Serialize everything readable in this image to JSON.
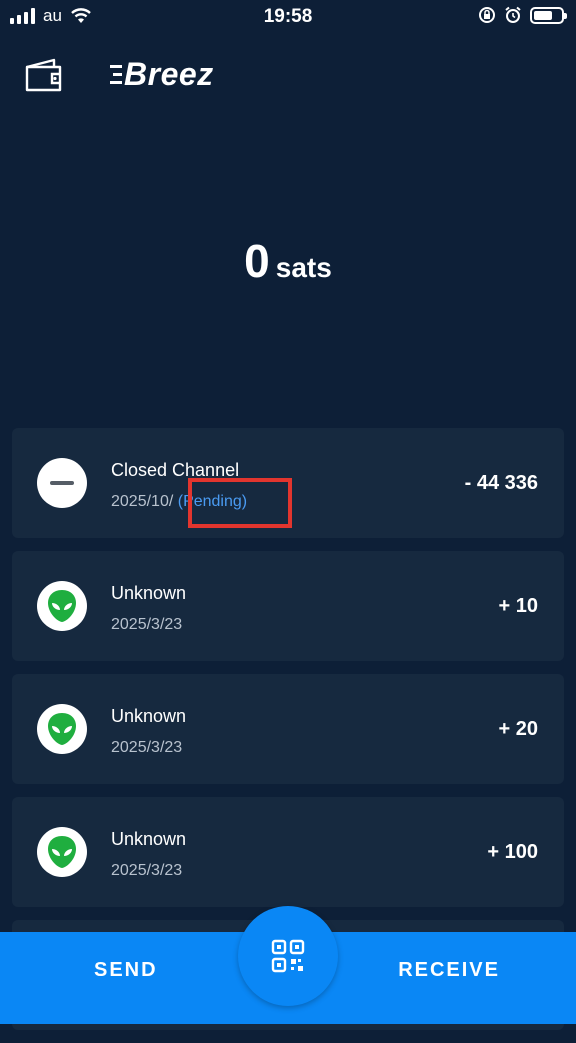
{
  "status_bar": {
    "carrier": "au",
    "time": "19:58"
  },
  "header": {
    "logo_text": "Breez"
  },
  "balance": {
    "amount": "0",
    "unit": "sats"
  },
  "transactions": [
    {
      "title": "Closed Channel",
      "date": "2025/10/",
      "status": "(Pending)",
      "amount": "- 44 336",
      "icon": "minus-icon"
    },
    {
      "title": "Unknown",
      "date": "2025/3/23",
      "amount": "+ 10",
      "icon": "alien-icon"
    },
    {
      "title": "Unknown",
      "date": "2025/3/23",
      "amount": "+ 20",
      "icon": "alien-icon"
    },
    {
      "title": "Unknown",
      "date": "2025/3/23",
      "amount": "+ 100",
      "icon": "alien-icon"
    }
  ],
  "bottom_bar": {
    "send_label": "SEND",
    "receive_label": "RECEIVE"
  },
  "colors": {
    "background": "#0d1f37",
    "card": "#16293f",
    "accent": "#0a87f5",
    "pending": "#4a9bf2",
    "highlight": "#e2352e",
    "alien": "#1fae3f"
  }
}
